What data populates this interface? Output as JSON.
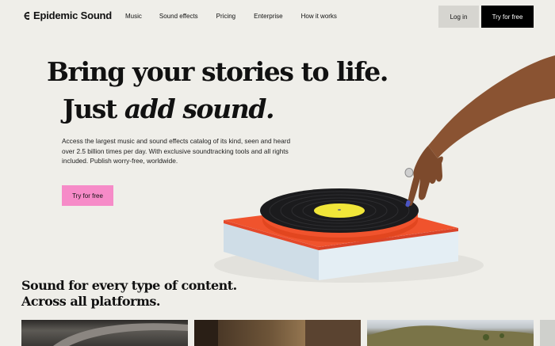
{
  "brand": {
    "name": "Epidemic Sound"
  },
  "nav": {
    "links": [
      "Music",
      "Sound effects",
      "Pricing",
      "Enterprise",
      "How it works"
    ],
    "login_label": "Log in",
    "try_label": "Try for free"
  },
  "hero": {
    "title_line1": "Bring your stories to life.",
    "title_line2_plain": "Just ",
    "title_line2_italic": "add sound.",
    "body": "Access the largest music and sound effects catalog of its kind, seen and heard over 2.5 billion times per day. With exclusive soundtracking tools and all rights included. Publish worry-free, worldwide.",
    "cta_label": "Try for free"
  },
  "section": {
    "title_line1": "Sound for every type of content.",
    "title_line2": "Across all platforms."
  },
  "colors": {
    "background": "#efeee9",
    "cta_pink": "#f68bc8",
    "turntable_orange": "#f0532d",
    "turntable_base": "#d9e6ef",
    "label_yellow": "#f1e639"
  }
}
